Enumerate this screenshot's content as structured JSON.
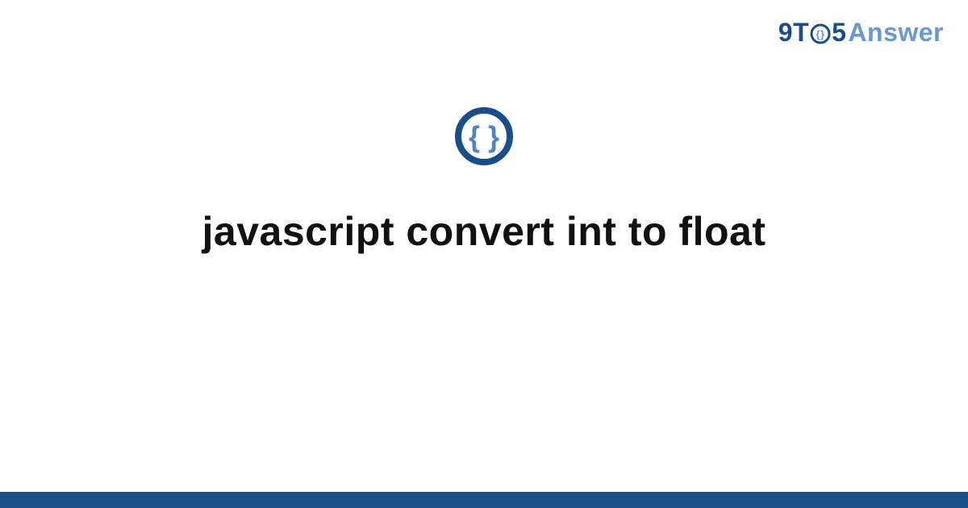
{
  "brand": {
    "nine": "9",
    "t": "T",
    "five": "5",
    "answer": "Answer"
  },
  "icon": {
    "name": "braces-circle-icon",
    "ring_color": "#1a4e8a",
    "glyph_color": "#4f85c4"
  },
  "title": "javascript convert int to float",
  "footer_color": "#1a4e8a"
}
